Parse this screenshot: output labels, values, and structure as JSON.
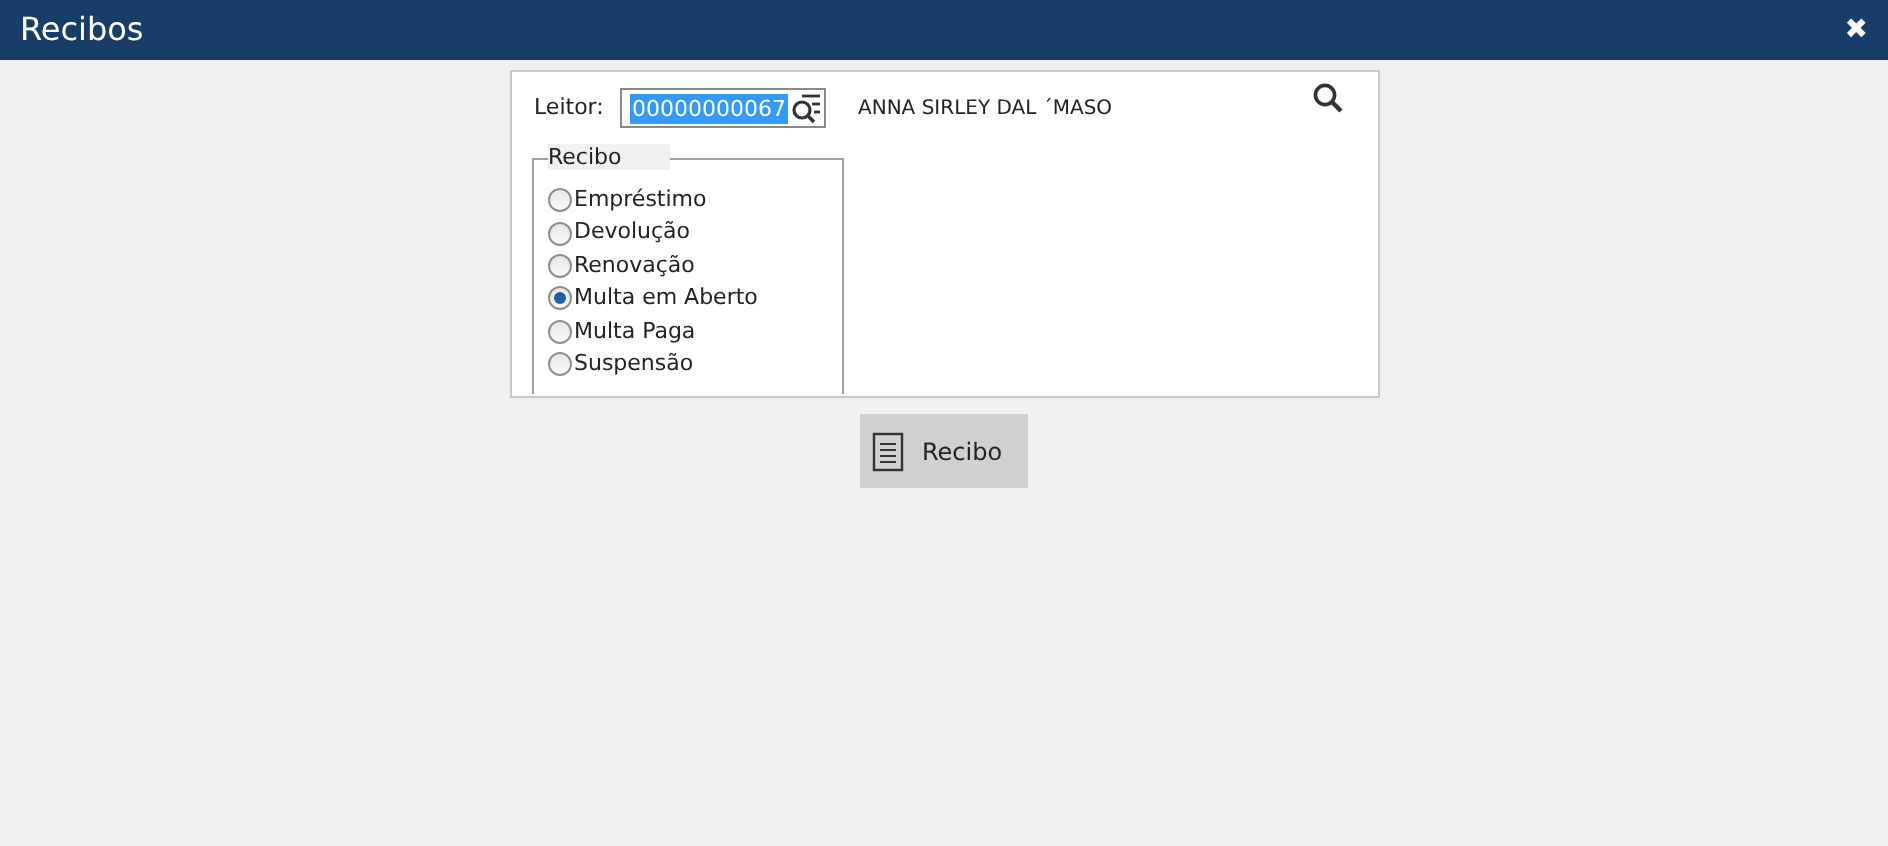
{
  "window": {
    "title": "Recibos",
    "close": "✖"
  },
  "form": {
    "reader_label": "Leitor:",
    "reader_value": "00000000067",
    "reader_name": "ANNA SIRLEY DAL ´MASO",
    "group_title": "Recibo",
    "options": [
      {
        "label": "Empréstimo",
        "selected": false
      },
      {
        "label": "Devolução",
        "selected": false
      },
      {
        "label": "Renovação",
        "selected": false
      },
      {
        "label": "Multa em Aberto",
        "selected": true
      },
      {
        "label": "Multa Paga",
        "selected": false
      },
      {
        "label": "Suspensão",
        "selected": false
      }
    ]
  },
  "action_button": "Recibo"
}
